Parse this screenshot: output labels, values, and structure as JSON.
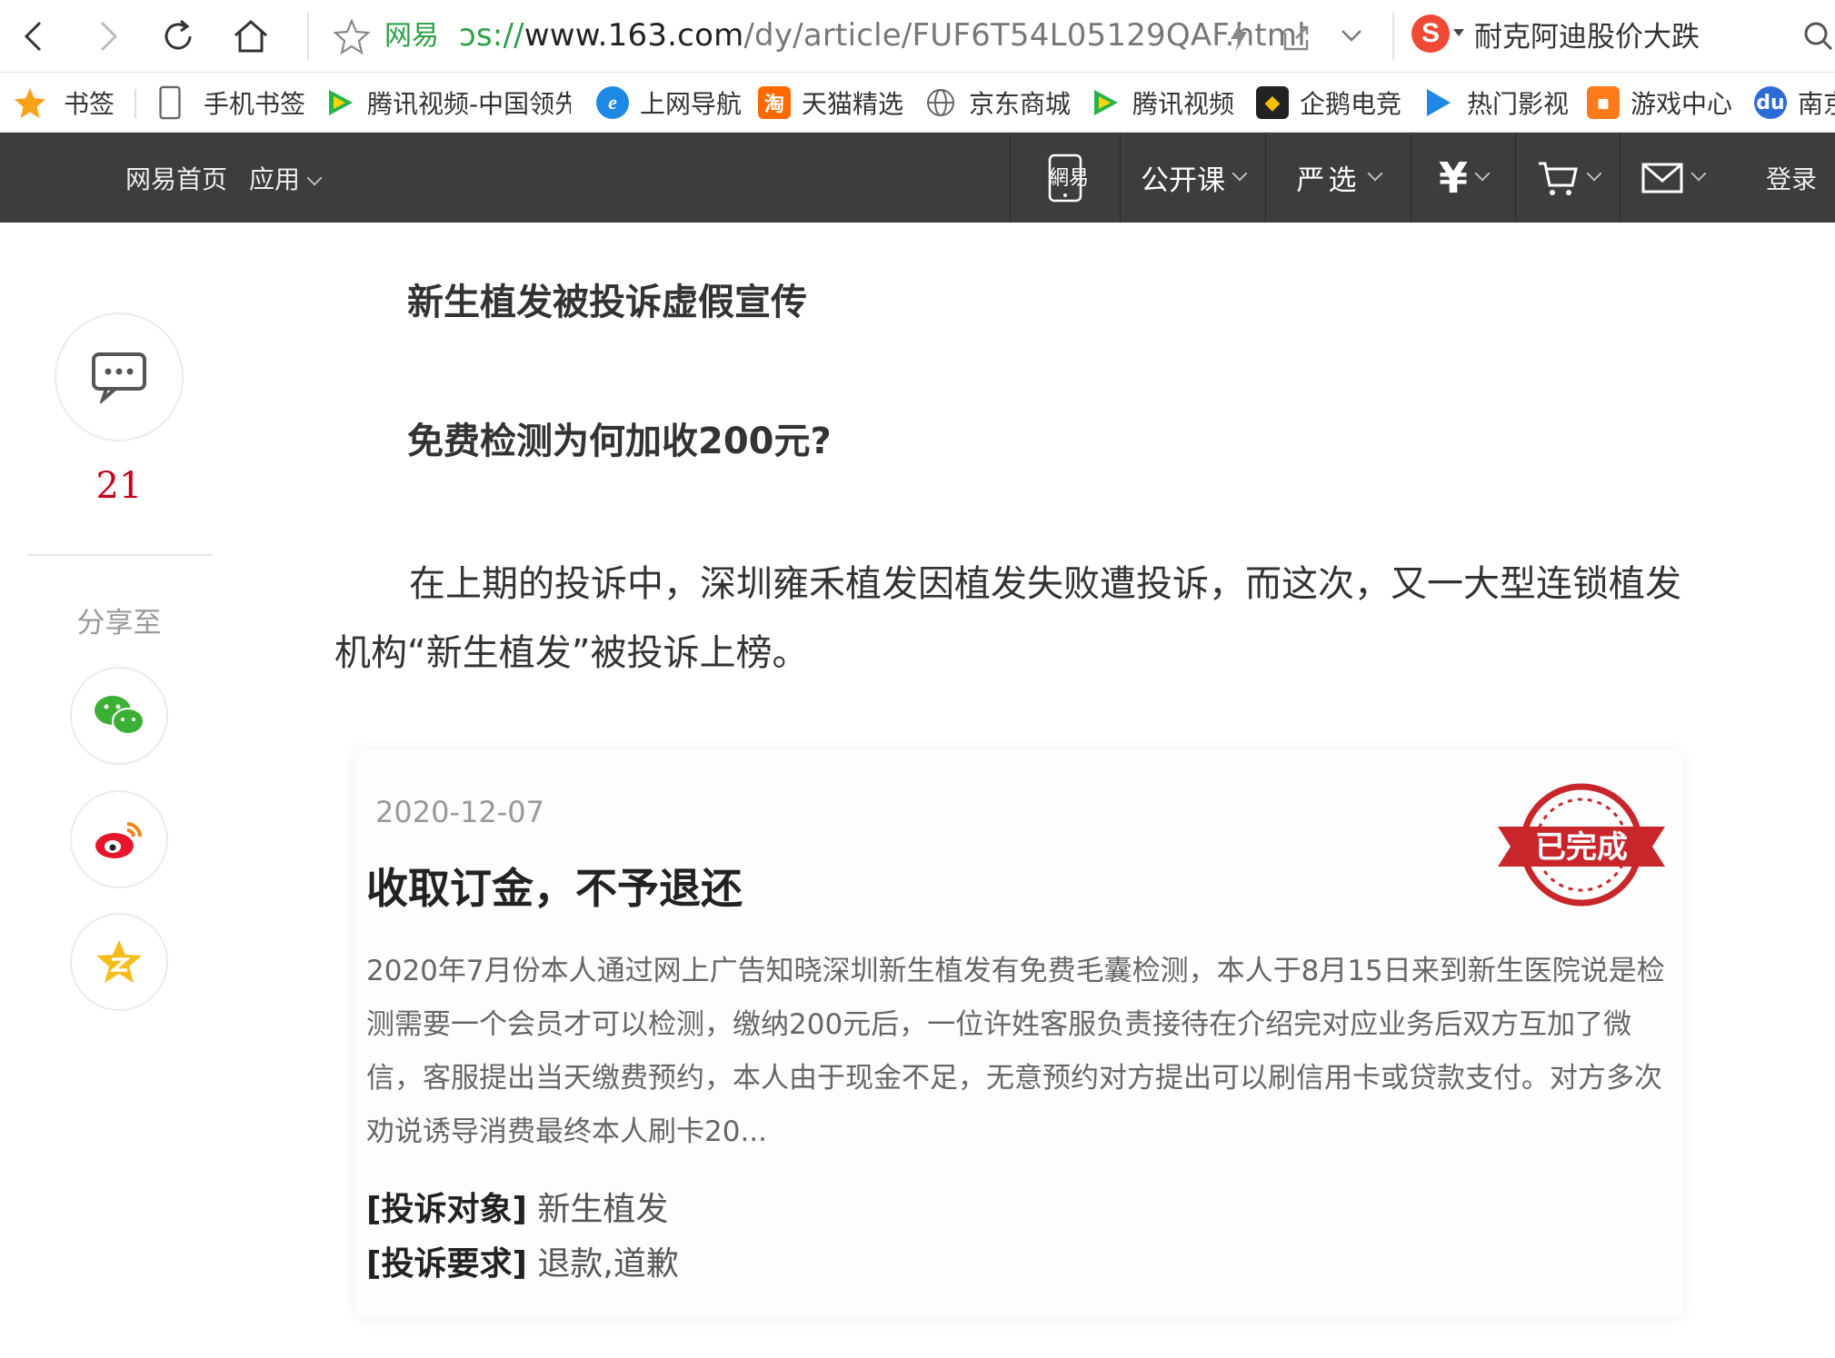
{
  "browser": {
    "site_tag": "网易",
    "url_prefix": "ɔs://",
    "url_host": "www.163.com",
    "url_path": "/dy/article/FUF6T54L05129QAF.html",
    "search_engine_icon": "sogou-icon",
    "search_query": "耐克阿迪股价大跌"
  },
  "bookmarks": [
    {
      "label": "书签",
      "icon": "star-icon",
      "color": "#f7a21b"
    },
    {
      "label": "手机书签",
      "icon": "phone-icon",
      "color": "#666666"
    },
    {
      "label": "腾讯视频-中国领先",
      "icon": "tencent-video-icon",
      "color": "#27b34b"
    },
    {
      "label": "上网导航",
      "icon": "ie-icon",
      "color": "#1e88e5"
    },
    {
      "label": "天猫精选",
      "icon": "tmall-icon",
      "color": "#ff6a00"
    },
    {
      "label": "京东商城",
      "icon": "globe-icon",
      "color": "#666666"
    },
    {
      "label": "腾讯视频",
      "icon": "tencent-video-icon",
      "color": "#27b34b"
    },
    {
      "label": "企鹅电竞",
      "icon": "penguin-esports-icon",
      "color": "#222222"
    },
    {
      "label": "热门影视",
      "icon": "play-icon",
      "color": "#1e88e5"
    },
    {
      "label": "游戏中心",
      "icon": "gamepad-icon",
      "color": "#ff7a1a"
    },
    {
      "label": "南京",
      "icon": "baidu-icon",
      "color": "#2d6bd7"
    }
  ],
  "site_nav": {
    "home": "网易首页",
    "apps": "应用",
    "mobile_logo": "網易",
    "open_course": "公开课",
    "yanxuan": "严选",
    "login": "登录"
  },
  "rail": {
    "comment_count": "21",
    "share_label": "分享至"
  },
  "article": {
    "heading1": "新生植发被投诉虚假宣传",
    "heading2": "免费检测为何加收200元?",
    "paragraph": "在上期的投诉中，深圳雍禾植发因植发失败遭投诉，而这次，又一大型连锁植发机构“新生植发”被投诉上榜。"
  },
  "complaint_card": {
    "date": "2020-12-07",
    "title": "收取订金，不予退还",
    "body": "2020年7月份本人通过网上广告知晓深圳新生植发有免费毛囊检测，本人于8月15日来到新生医院说是检测需要一个会员才可以检测，缴纳200元后，一位许姓客服负责接待在介绍完对应业务后双方互加了微信，客服提出当天缴费预约，本人由于现金不足，无意预约对方提出可以刷信用卡或贷款支付。对方多次劝说诱导消费最终本人刷卡20...",
    "target_key": "[投诉对象]",
    "target_value": "新生植发",
    "demand_key": "[投诉要求]",
    "demand_value": "退款,道歉",
    "stamp_text": "已完成",
    "stamp_color": "#c8262b"
  }
}
